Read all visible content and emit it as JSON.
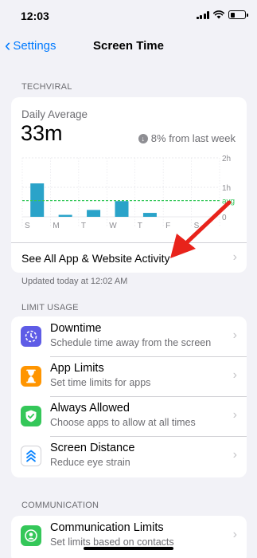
{
  "status": {
    "time": "12:03"
  },
  "nav": {
    "back_label": "Settings",
    "title": "Screen Time"
  },
  "device_section": {
    "header": "TECHVIRAL"
  },
  "daily": {
    "label": "Daily Average",
    "value": "33m",
    "change": "8% from last week",
    "see_all": "See All App & Website Activity",
    "updated": "Updated today at 12:02 AM"
  },
  "chart_data": {
    "type": "bar",
    "categories": [
      "S",
      "M",
      "T",
      "W",
      "T",
      "F",
      "S"
    ],
    "values": [
      68,
      4,
      14,
      32,
      8,
      0,
      0
    ],
    "unit": "minutes",
    "y_ticks": [
      "2h",
      "1h",
      "0"
    ],
    "average_label": "avg",
    "ylim": [
      0,
      120
    ],
    "average_value": 33,
    "bar_color": "#2aa3c9",
    "average_color": "#34c759"
  },
  "limit_section": {
    "header": "LIMIT USAGE",
    "items": [
      {
        "title": "Downtime",
        "subtitle": "Schedule time away from the screen",
        "icon": "moon-clock-icon",
        "color": "#5e5ce6"
      },
      {
        "title": "App Limits",
        "subtitle": "Set time limits for apps",
        "icon": "hourglass-icon",
        "color": "#ff9500"
      },
      {
        "title": "Always Allowed",
        "subtitle": "Choose apps to allow at all times",
        "icon": "checkmark-shield-icon",
        "color": "#34c759"
      },
      {
        "title": "Screen Distance",
        "subtitle": "Reduce eye strain",
        "icon": "chevrons-up-icon",
        "color": "#ffffff"
      }
    ]
  },
  "communication_section": {
    "header": "COMMUNICATION",
    "items": [
      {
        "title": "Communication Limits",
        "subtitle": "Set limits based on contacts",
        "icon": "person-circle-icon",
        "color": "#34c759"
      }
    ]
  }
}
